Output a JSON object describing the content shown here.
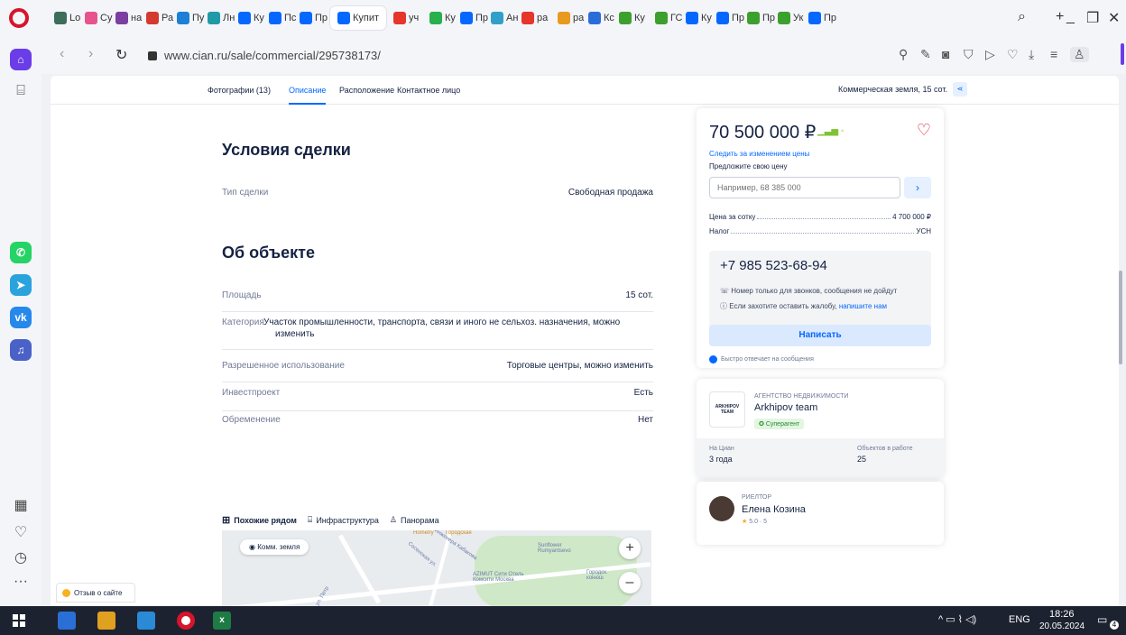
{
  "browser": {
    "tabs": [
      {
        "label": "Lo",
        "color": "#3c6e5a"
      },
      {
        "label": "Cy",
        "color": "#e7538d"
      },
      {
        "label": "на",
        "color": "#7a3fa0"
      },
      {
        "label": "Ра",
        "color": "#d43a2f"
      },
      {
        "label": "Пу",
        "color": "#1d7fd6"
      },
      {
        "label": "Лн",
        "color": "#1f9aa6"
      },
      {
        "label": "Ку",
        "color": "#0468ff"
      },
      {
        "label": "Пс",
        "color": "#0468ff"
      },
      {
        "label": "Пр",
        "color": "#0468ff"
      },
      {
        "label": "Купит",
        "color": "#0468ff"
      },
      {
        "label": "уч",
        "color": "#e6352b"
      },
      {
        "label": "Ку",
        "color": "#27b04b"
      },
      {
        "label": "Пр",
        "color": "#0468ff"
      },
      {
        "label": "Ан",
        "color": "#30a0c8"
      },
      {
        "label": "ра",
        "color": "#e6352b"
      },
      {
        "label": "ра",
        "color": "#e89a1f"
      },
      {
        "label": "Кс",
        "color": "#2b6dd8"
      },
      {
        "label": "Ку",
        "color": "#3ca02e"
      },
      {
        "label": "ГС",
        "color": "#3ca02e"
      },
      {
        "label": "Ку",
        "color": "#0468ff"
      },
      {
        "label": "Пр",
        "color": "#0468ff"
      },
      {
        "label": "Пр",
        "color": "#3ca02e"
      },
      {
        "label": "Ук",
        "color": "#3ca02e"
      },
      {
        "label": "Пр",
        "color": "#0468ff"
      }
    ],
    "url": "www.cian.ru/sale/commercial/295738173/"
  },
  "subnav": {
    "items": [
      "Фотографии (13)",
      "Описание",
      "Расположение",
      "Контактное лицо"
    ],
    "right_label": "Коммерческая земля, 15 сот."
  },
  "deal": {
    "title": "Условия сделки",
    "type_label": "Тип сделки",
    "type_value": "Свободная продажа"
  },
  "object": {
    "title": "Об объекте",
    "area_label": "Площадь",
    "area_value": "15 сот.",
    "category_label": "Категория",
    "category_value_line1": "Участок промышленности, транспорта, связи и иного не сельхоз. назначения, можно",
    "category_value_line2": "изменить",
    "usage_label": "Разрешенное использование",
    "usage_value": "Торговые центры, можно изменить",
    "invest_label": "Инвестпроект",
    "invest_value": "Есть",
    "burden_label": "Обременение",
    "burden_value": "Нет"
  },
  "map_tabs": [
    "Похожие рядом",
    "Инфраструктура",
    "Панорама"
  ],
  "map": {
    "pill": "Комм. земля",
    "labels": [
      "Hometry",
      "Городская",
      "Sunflower Rumyantsevo",
      "AZIMUT Сити Отель Комсити Москва",
      "Городск. конюш",
      "ул. Петр",
      "Сосенская ул.",
      "ул. Инженера Кабакова"
    ]
  },
  "price_card": {
    "price": "70 500 000 ₽",
    "follow": "Следить за изменением цены",
    "offer_label": "Предложите свою цену",
    "offer_placeholder": "Например, 68 385 000",
    "per_sotka_label": "Цена за сотку",
    "per_sotka_value": "4 700 000 ₽",
    "tax_label": "Налог",
    "tax_value": "УСН",
    "phone": "+7 985 523-68-94",
    "note1": "Номер только для звонков, сообщения не дойдут",
    "note2_prefix": "Если захотите оставить жалобу,",
    "note2_link": "напишите нам",
    "write": "Написать",
    "fast_reply": "Быстро отвечает на сообщения"
  },
  "agency_card": {
    "type": "АГЕНТСТВО НЕДВИЖИМОСТИ",
    "name": "Arkhipov team",
    "badge": "Суперагент",
    "on_cian_label": "На Циан",
    "on_cian_value": "3 года",
    "objects_label": "Объектов в работе",
    "objects_value": "25",
    "logo_text": "ARKHIPOV TEAM"
  },
  "realtor_card": {
    "type": "РИЕЛТОР",
    "name": "Елена Козина",
    "rating": "5.0 · 5"
  },
  "feedback": "Отзыв о сайте",
  "taskbar": {
    "lang": "ENG",
    "time": "18:26",
    "date": "20.05.2024",
    "notif": "4"
  }
}
